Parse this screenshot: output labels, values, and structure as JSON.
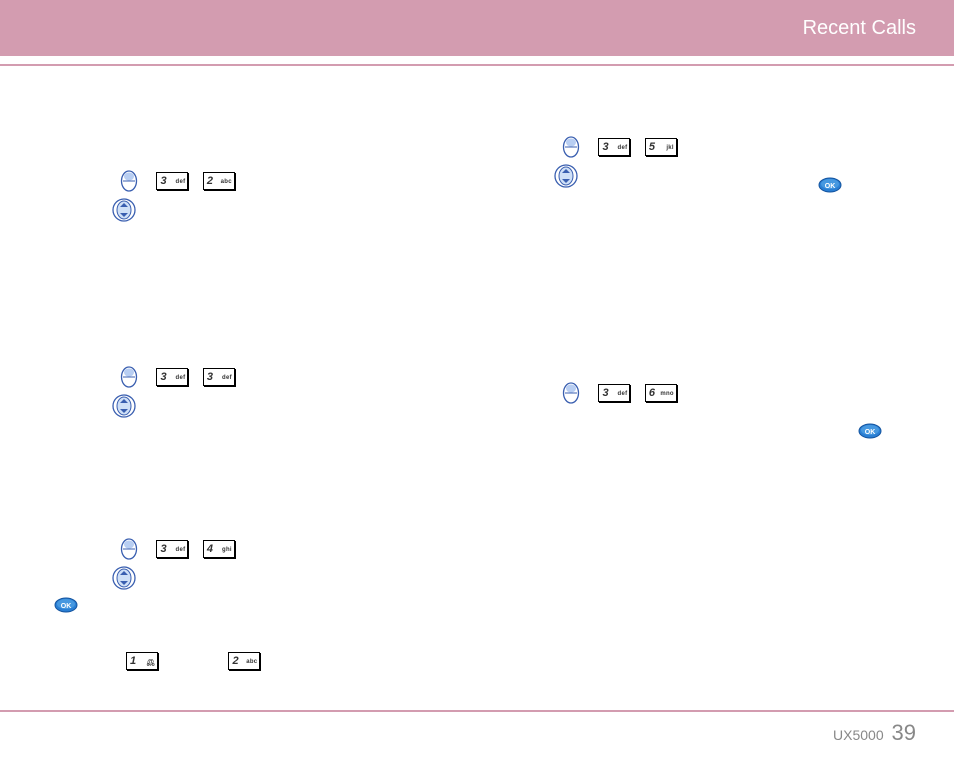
{
  "header": {
    "title": "Recent Calls"
  },
  "footer": {
    "model": "UX5000",
    "page": "39"
  },
  "keys": {
    "k1": {
      "digit": "1",
      "sub": "@\n o.o"
    },
    "k2": {
      "digit": "2",
      "sub": "abc"
    },
    "k3": {
      "digit": "3",
      "sub": "def"
    },
    "k4": {
      "digit": "4",
      "sub": "ghi"
    },
    "k5": {
      "digit": "5",
      "sub": "jkl"
    },
    "k6": {
      "digit": "6",
      "sub": "mno"
    }
  }
}
